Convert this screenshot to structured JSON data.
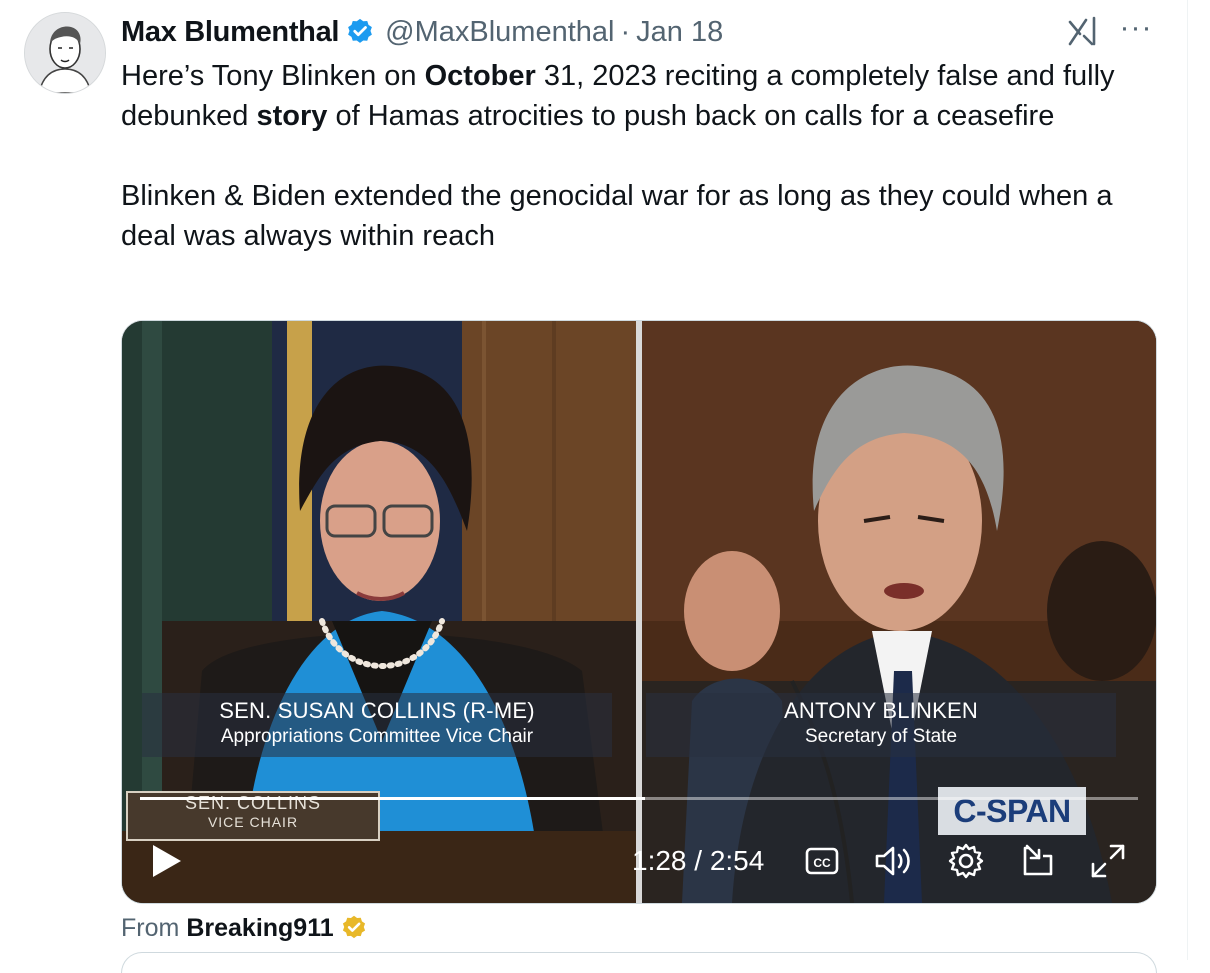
{
  "tweet": {
    "author_name": "Max Blumenthal",
    "handle": "@MaxBlumenthal",
    "separator": "·",
    "date": "Jan 18",
    "more_label": "···",
    "text_1a": "Here’s Tony Blinken on ",
    "text_1b": "October",
    "text_1c": " 31, 2023 reciting a completely false and fully debunked ",
    "text_1d": "story",
    "text_1e": " of Hamas atrocities to push back on calls for a ceasefire",
    "text_2": "Blinken & Biden extended the genocidal war for as long as they could when a deal was always within reach"
  },
  "video": {
    "left_caption_name": "SEN. SUSAN COLLINS (R-ME)",
    "left_caption_title": "Appropriations Committee Vice Chair",
    "nameplate_line1": "SEN. COLLINS",
    "nameplate_line2": "VICE CHAIR",
    "right_caption_name": "ANTONY BLINKEN",
    "right_caption_title": "Secretary of State",
    "network_logo": "C-SPAN",
    "time_display": "1:28 / 2:54",
    "progress": 0.506
  },
  "source": {
    "label": "From",
    "account": "Breaking911"
  },
  "colors": {
    "verified_blue": "#1d9bf0",
    "verified_gold": "#e8b829",
    "muted_text": "#536471"
  },
  "icons": [
    "avatar",
    "verified-badge-icon",
    "grok-icon",
    "more-icon",
    "play-icon",
    "cc-icon",
    "volume-icon",
    "settings-icon",
    "pip-icon",
    "fullscreen-icon",
    "gold-verified-icon"
  ]
}
